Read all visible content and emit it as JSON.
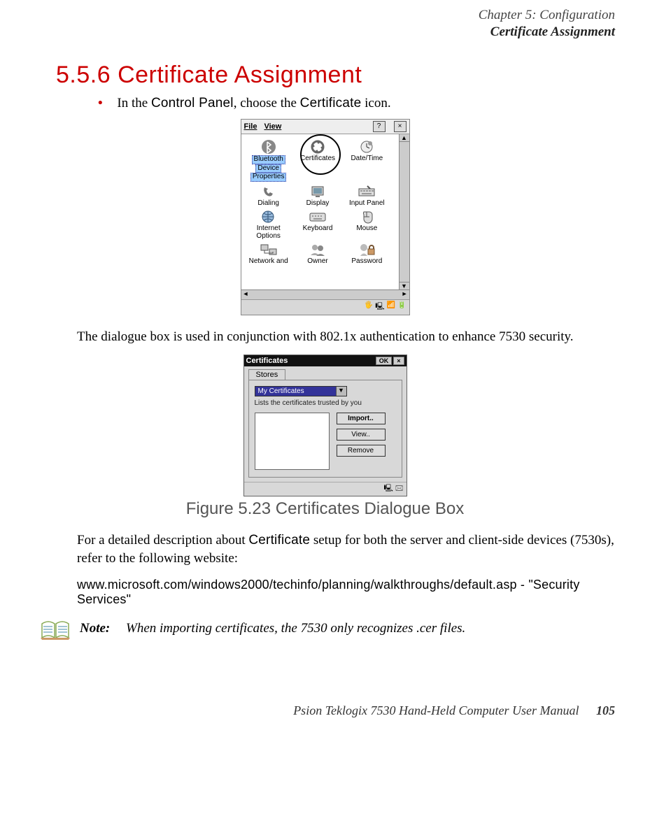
{
  "header": {
    "chapter": "Chapter 5: Configuration",
    "section": "Certificate Assignment"
  },
  "section_title": "5.5.6   Certificate Assignment",
  "bullet": {
    "prefix": "In the ",
    "ui1": "Control Panel",
    "mid": ", choose the ",
    "ui2": "Certificate",
    "suffix": " icon."
  },
  "shot1": {
    "menu_file": "File",
    "menu_view": "View",
    "help_btn": "?",
    "close_btn": "×",
    "icons": [
      {
        "label_a": "Bluetooth",
        "label_b": "Device",
        "label_c": "Properties",
        "selected": true
      },
      {
        "label_a": "Certificates"
      },
      {
        "label_a": "Date/Time"
      },
      {
        "label_a": "Dialing"
      },
      {
        "label_a": "Display"
      },
      {
        "label_a": "Input Panel"
      },
      {
        "label_a": "Internet",
        "label_b": "Options"
      },
      {
        "label_a": "Keyboard"
      },
      {
        "label_a": "Mouse"
      },
      {
        "label_a": "Network and"
      },
      {
        "label_a": "Owner"
      },
      {
        "label_a": "Password"
      }
    ],
    "hscroll_left": "◄",
    "hscroll_right": "►",
    "vscroll_up": "▲",
    "vscroll_down": "▼"
  },
  "para1": "The dialogue box is used in conjunction with 802.1x authentication to enhance 7530 security.",
  "shot2": {
    "title": "Certificates",
    "ok": "OK",
    "close": "×",
    "tab": "Stores",
    "combo_value": "My Certificates",
    "combo_arrow": "▼",
    "hint": "Lists the certificates trusted by you",
    "btn_import": "Import..",
    "btn_view": "View..",
    "btn_remove": "Remove"
  },
  "figure_caption": "Figure 5.23 Certificates Dialogue Box",
  "para2": {
    "a": "For a detailed description about ",
    "ui": "Certificate",
    "b": " setup for both the server and client-side devices (7530s), refer to the following website:"
  },
  "url_line": "www.microsoft.com/windows2000/techinfo/planning/walkthroughs/default.asp - \"Security Services\"",
  "note": {
    "label": "Note:",
    "text": "When importing certificates, the 7530 only recognizes .cer files."
  },
  "footer": {
    "text": "Psion Teklogix 7530 Hand-Held Computer User Manual",
    "page": "105"
  }
}
